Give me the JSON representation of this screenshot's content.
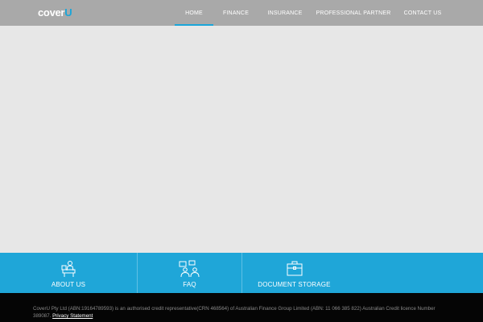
{
  "header": {
    "logo": {
      "main": "cover",
      "accent": "U"
    },
    "nav": [
      {
        "label": "HOME",
        "active": true
      },
      {
        "label": "FINANCE",
        "active": false
      },
      {
        "label": "INSURANCE",
        "active": false
      },
      {
        "label": "PROFESSIONAL PARTNER",
        "active": false
      },
      {
        "label": "CONTACT US",
        "active": false
      }
    ]
  },
  "tiles": [
    {
      "label": "ABOUT US",
      "icon": "person-at-desk-icon"
    },
    {
      "label": "FAQ",
      "icon": "people-chat-icon"
    },
    {
      "label": "DOCUMENT STORAGE",
      "icon": "briefcase-icon"
    }
  ],
  "footer": {
    "text": "CoverU Pty Ltd (ABN:19164789593) is an authorised credit representative(CRN 468564) of Australian Finance Group Limited (ABN: 11 066 385 822) Australian Credit licence Number 389087.",
    "link": "Privacy Statement"
  },
  "colors": {
    "header_bg": "#a9a9a9",
    "accent": "#1aa6d9",
    "tiles_bg": "#1fa6d8",
    "hero_bg": "#e7e7e7",
    "footer_bg": "#050505"
  }
}
